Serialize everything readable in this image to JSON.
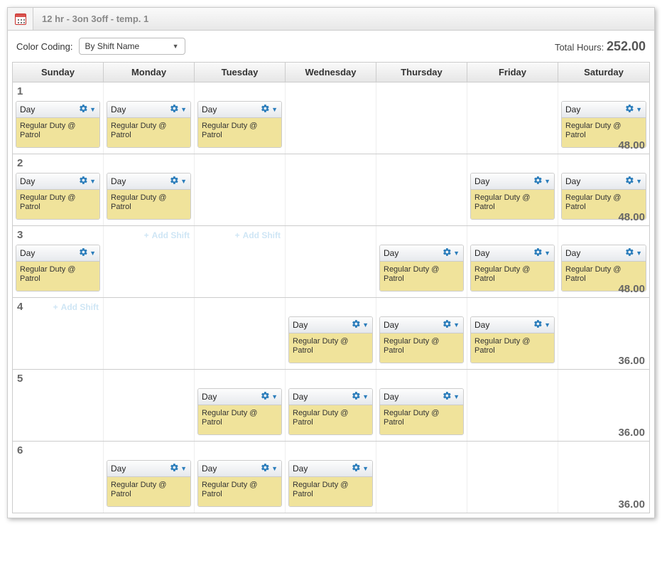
{
  "title": "12 hr - 3on 3off - temp. 1",
  "controls": {
    "color_coding_label": "Color Coding:",
    "color_coding_selected": "By Shift Name"
  },
  "total": {
    "label": "Total Hours:",
    "value": "252.00"
  },
  "day_headers": [
    "Sunday",
    "Monday",
    "Tuesday",
    "Wednesday",
    "Thursday",
    "Friday",
    "Saturday"
  ],
  "shift": {
    "name": "Day",
    "body": "Regular Duty @ Patrol"
  },
  "add_shift_label": "Add Shift",
  "weeks": [
    {
      "num": "1",
      "hours": "48.00",
      "days": [
        true,
        true,
        true,
        false,
        false,
        false,
        true
      ],
      "add_hints": []
    },
    {
      "num": "2",
      "hours": "48.00",
      "days": [
        true,
        true,
        false,
        false,
        false,
        true,
        true
      ],
      "add_hints": []
    },
    {
      "num": "3",
      "hours": "48.00",
      "days": [
        true,
        false,
        false,
        false,
        true,
        true,
        true
      ],
      "add_hints": [
        1,
        2
      ]
    },
    {
      "num": "4",
      "hours": "36.00",
      "days": [
        false,
        false,
        false,
        true,
        true,
        true,
        false
      ],
      "add_hints": [
        0
      ]
    },
    {
      "num": "5",
      "hours": "36.00",
      "days": [
        false,
        false,
        true,
        true,
        true,
        false,
        false
      ],
      "add_hints": []
    },
    {
      "num": "6",
      "hours": "36.00",
      "days": [
        false,
        true,
        true,
        true,
        false,
        false,
        false
      ],
      "add_hints": []
    }
  ]
}
